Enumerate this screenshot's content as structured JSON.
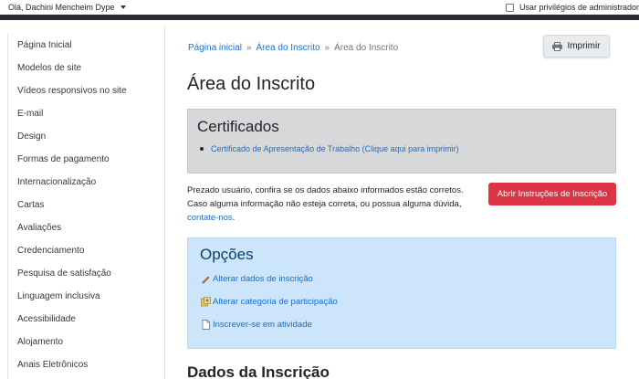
{
  "topbar": {
    "user_greeting": "Olá, Dachini Mencheim Dype",
    "admin_toggle_label": "Usar privilégios de administrador"
  },
  "sidebar": {
    "items": [
      {
        "label": "Página Inicial"
      },
      {
        "label": "Modelos de site"
      },
      {
        "label": "Vídeos responsivos no site"
      },
      {
        "label": "E-mail"
      },
      {
        "label": "Design"
      },
      {
        "label": "Formas de pagamento"
      },
      {
        "label": "Internacionalização"
      },
      {
        "label": "Cartas"
      },
      {
        "label": "Avaliações"
      },
      {
        "label": "Credenciamento"
      },
      {
        "label": "Pesquisa de satisfação"
      },
      {
        "label": "Linguagem inclusiva"
      },
      {
        "label": "Acessibilidade"
      },
      {
        "label": "Alojamento"
      },
      {
        "label": "Anais Eletrônicos"
      }
    ]
  },
  "breadcrumb": {
    "home": "Página inicial",
    "sep": "»",
    "parent": "Área do Inscrito",
    "current": "Área do Inscrito"
  },
  "print_button": {
    "label": "Imprimir",
    "icon": "printer-icon"
  },
  "page_title": "Área do Inscrito",
  "certificates": {
    "title": "Certificados",
    "link": "Certificado de Apresentação de Trabalho (Clique aqui para imprimir)"
  },
  "info": {
    "line1": "Prezado usuário, confira se os dados abaixo informados estão corretos.",
    "line2": "Caso alguma informação não esteja correta, ou possua alguma dúvida,",
    "link": "contate-nos",
    "suffix": "."
  },
  "instructions_button": {
    "label": "Abrir Instruções de Inscrição",
    "color": "#dc3545"
  },
  "options": {
    "title": "Opções",
    "items": [
      {
        "label": "Alterar dados de inscrição",
        "icon": "pencil-icon"
      },
      {
        "label": "Alterar categoria de participação",
        "icon": "category-icon"
      },
      {
        "label": "Inscrever-se em atividade",
        "icon": "document-icon"
      }
    ]
  },
  "registration_section": {
    "title": "Dados da Inscrição"
  },
  "colors": {
    "link": "#1a6ec9",
    "topbar_border": "#2b2f33",
    "cert_bg": "#d7d8da",
    "options_bg": "#cce5fb"
  }
}
